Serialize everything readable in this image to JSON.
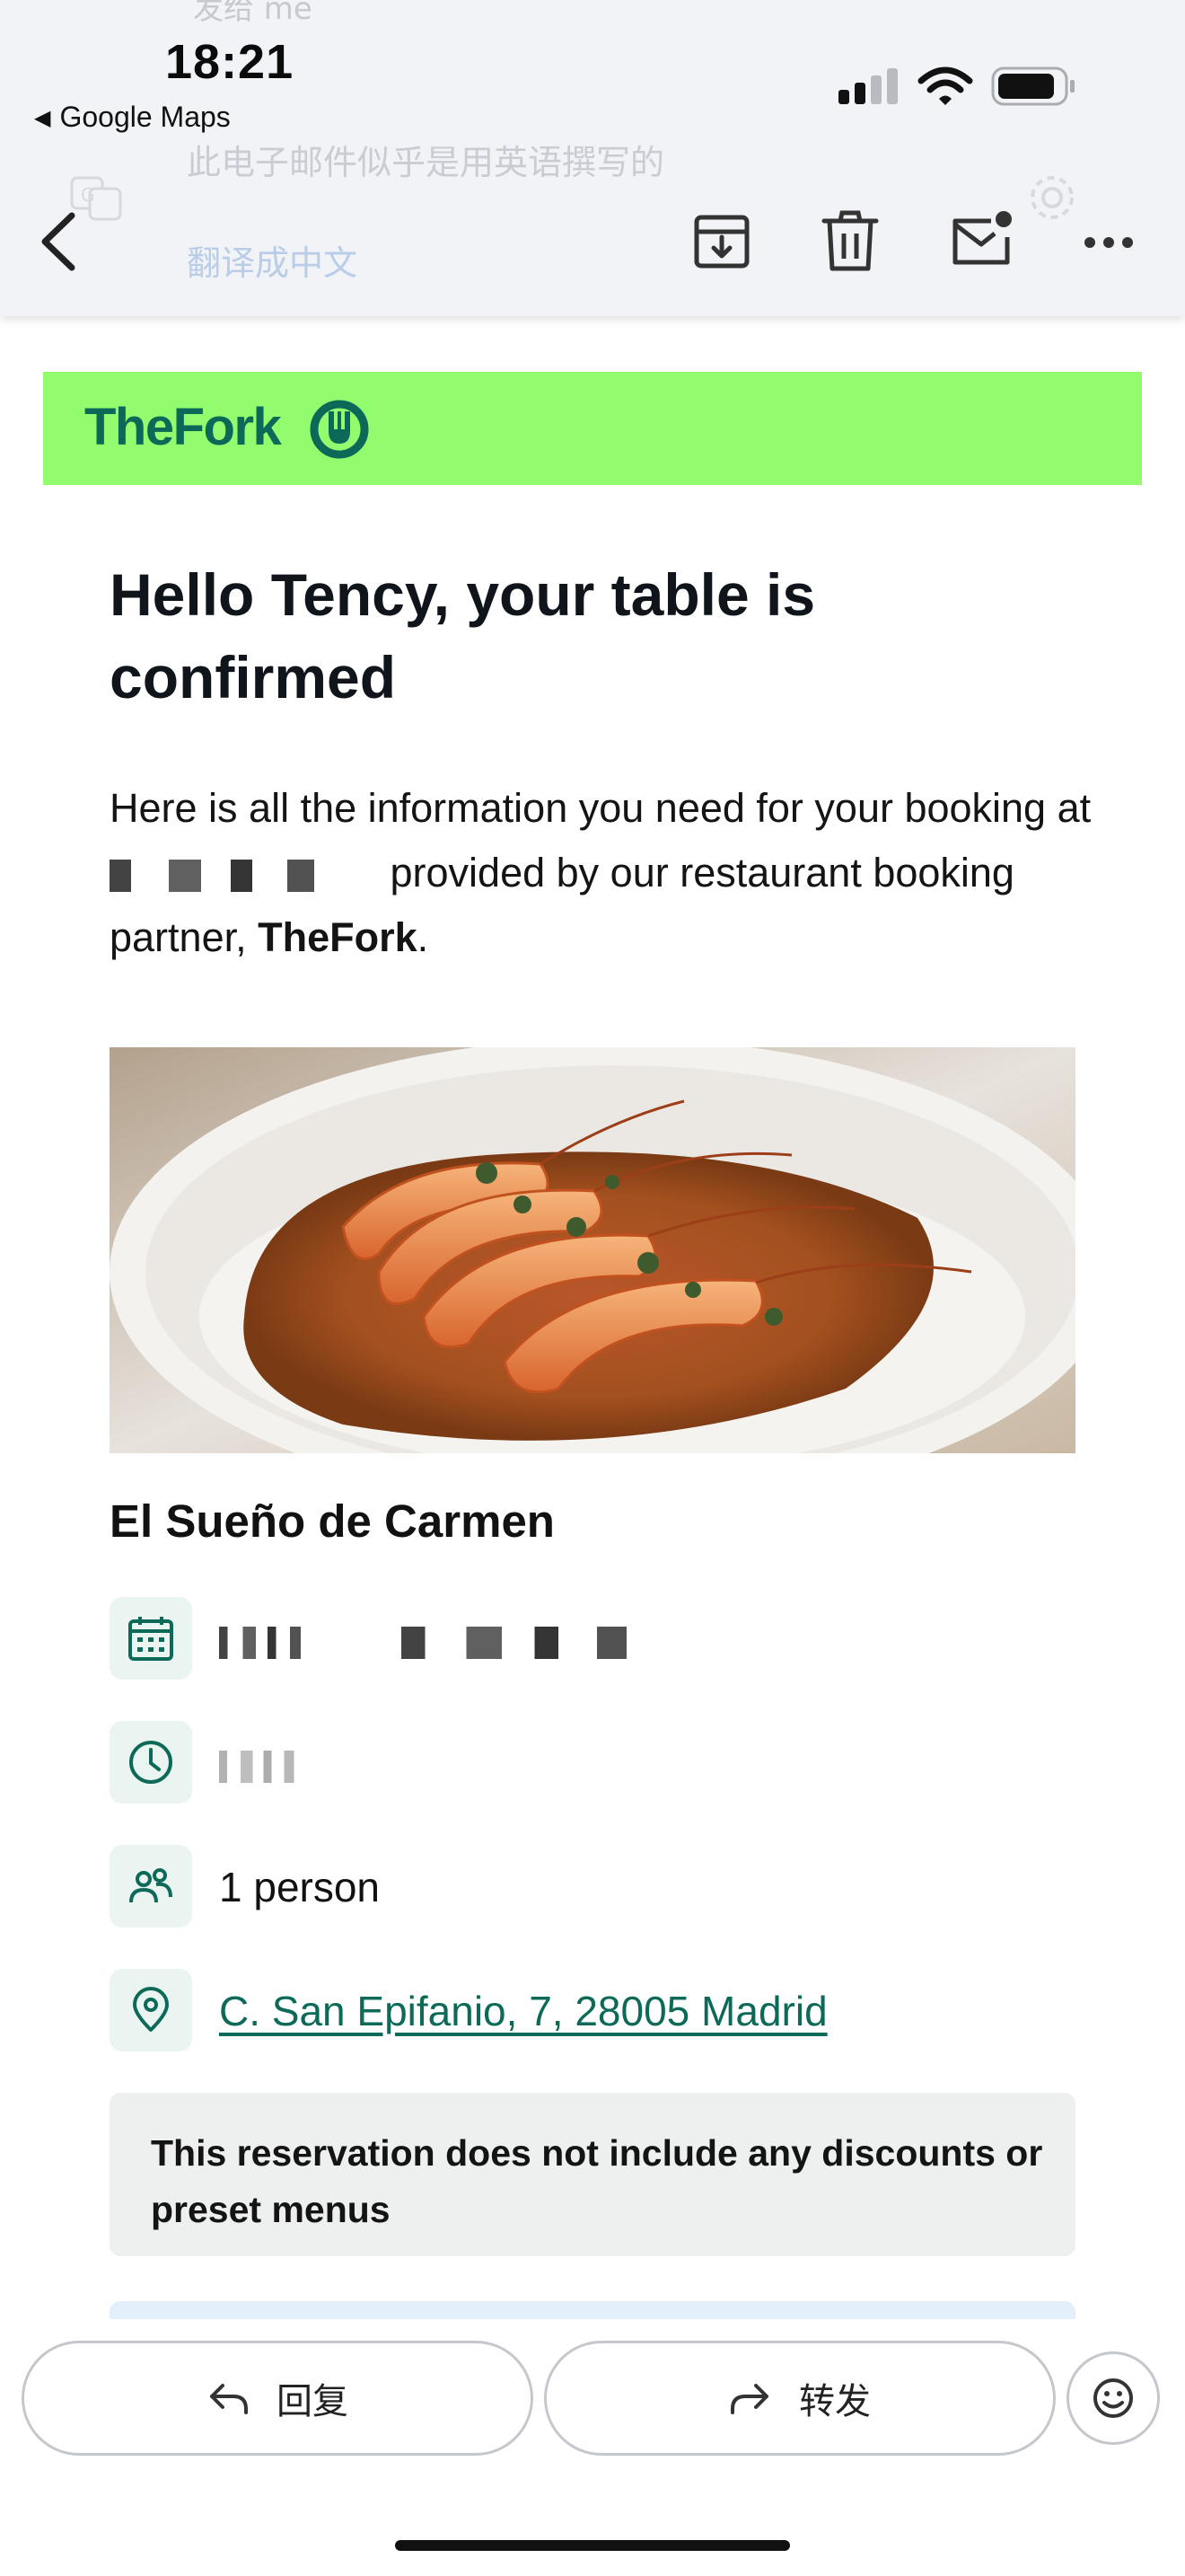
{
  "status_bar": {
    "time": "18:21",
    "back_to_app": "Google Maps",
    "icons": [
      "cellular-signal-icon",
      "wifi-icon",
      "battery-icon"
    ]
  },
  "mail_header_ghost": {
    "from_line": "发给 me",
    "language_notice": "此电子邮件似乎是用英语撰写的",
    "translate_link": "翻译成中文"
  },
  "toolbar": {
    "icons": [
      "back-arrow-icon",
      "archive-icon",
      "trash-icon",
      "mark-unread-icon",
      "more-icon"
    ]
  },
  "email": {
    "brand": {
      "logo_text": "TheFork",
      "banner_color": "#93fb6e",
      "logo_color": "#0d6957"
    },
    "headline": "Hello Tency, your table is confirmed",
    "intro": {
      "part1": "Here is all the information you need for your booking at",
      "part2": "provided by our restaurant booking partner,",
      "brand_bold": "TheFork",
      "end": "."
    },
    "photo_alt": "Shrimp over rice dish",
    "restaurant_name": "El Sueño de Carmen",
    "details": {
      "date": "",
      "time": "",
      "guests": "1 person",
      "address": "C. San Epifanio, 7, 28005 Madrid"
    },
    "notice": "This reservation does not include any discounts or preset menus",
    "accent_color": "#0e6a58"
  },
  "bottom_bar": {
    "reply_label": "回复",
    "forward_label": "转发",
    "icons": [
      "reply-arrow-icon",
      "forward-arrow-icon",
      "emoji-icon"
    ]
  }
}
